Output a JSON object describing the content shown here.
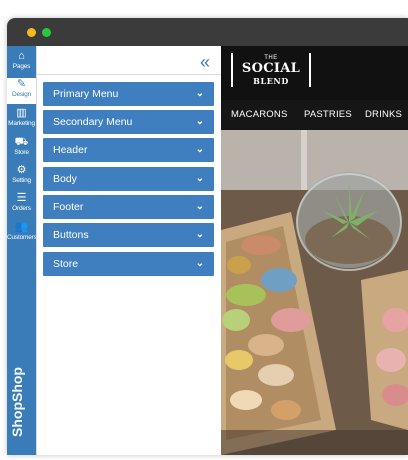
{
  "rail": {
    "items": [
      {
        "icon": "pages-icon",
        "glyph": "⌂",
        "label": "Pages"
      },
      {
        "icon": "brush-icon",
        "glyph": "✎",
        "label": "Design"
      },
      {
        "icon": "chart-icon",
        "glyph": "▥",
        "label": "Marketing"
      },
      {
        "icon": "cart-icon",
        "glyph": "⛟",
        "label": "Store"
      },
      {
        "icon": "gear-icon",
        "glyph": "⚙",
        "label": "Setting"
      },
      {
        "icon": "list-icon",
        "glyph": "☰",
        "label": "Orders"
      },
      {
        "icon": "users-icon",
        "glyph": "👥",
        "label": "Customers"
      }
    ],
    "brand": "ShopShop"
  },
  "panel": {
    "collapse_glyph": "«",
    "sections": [
      {
        "label": "Primary Menu"
      },
      {
        "label": "Secondary Menu"
      },
      {
        "label": "Header"
      },
      {
        "label": "Body"
      },
      {
        "label": "Footer"
      },
      {
        "label": "Buttons"
      },
      {
        "label": "Store"
      }
    ],
    "chevron": "⌄"
  },
  "site": {
    "logo": {
      "the": "THE",
      "social": "SOCIAL",
      "blend": "BLEND"
    },
    "nav": [
      "MACARONS",
      "PASTRIES",
      "DRINKS"
    ]
  },
  "colors": {
    "accent": "#3f7fbf",
    "rail": "#3a7cb8",
    "site_bg": "#111111"
  }
}
